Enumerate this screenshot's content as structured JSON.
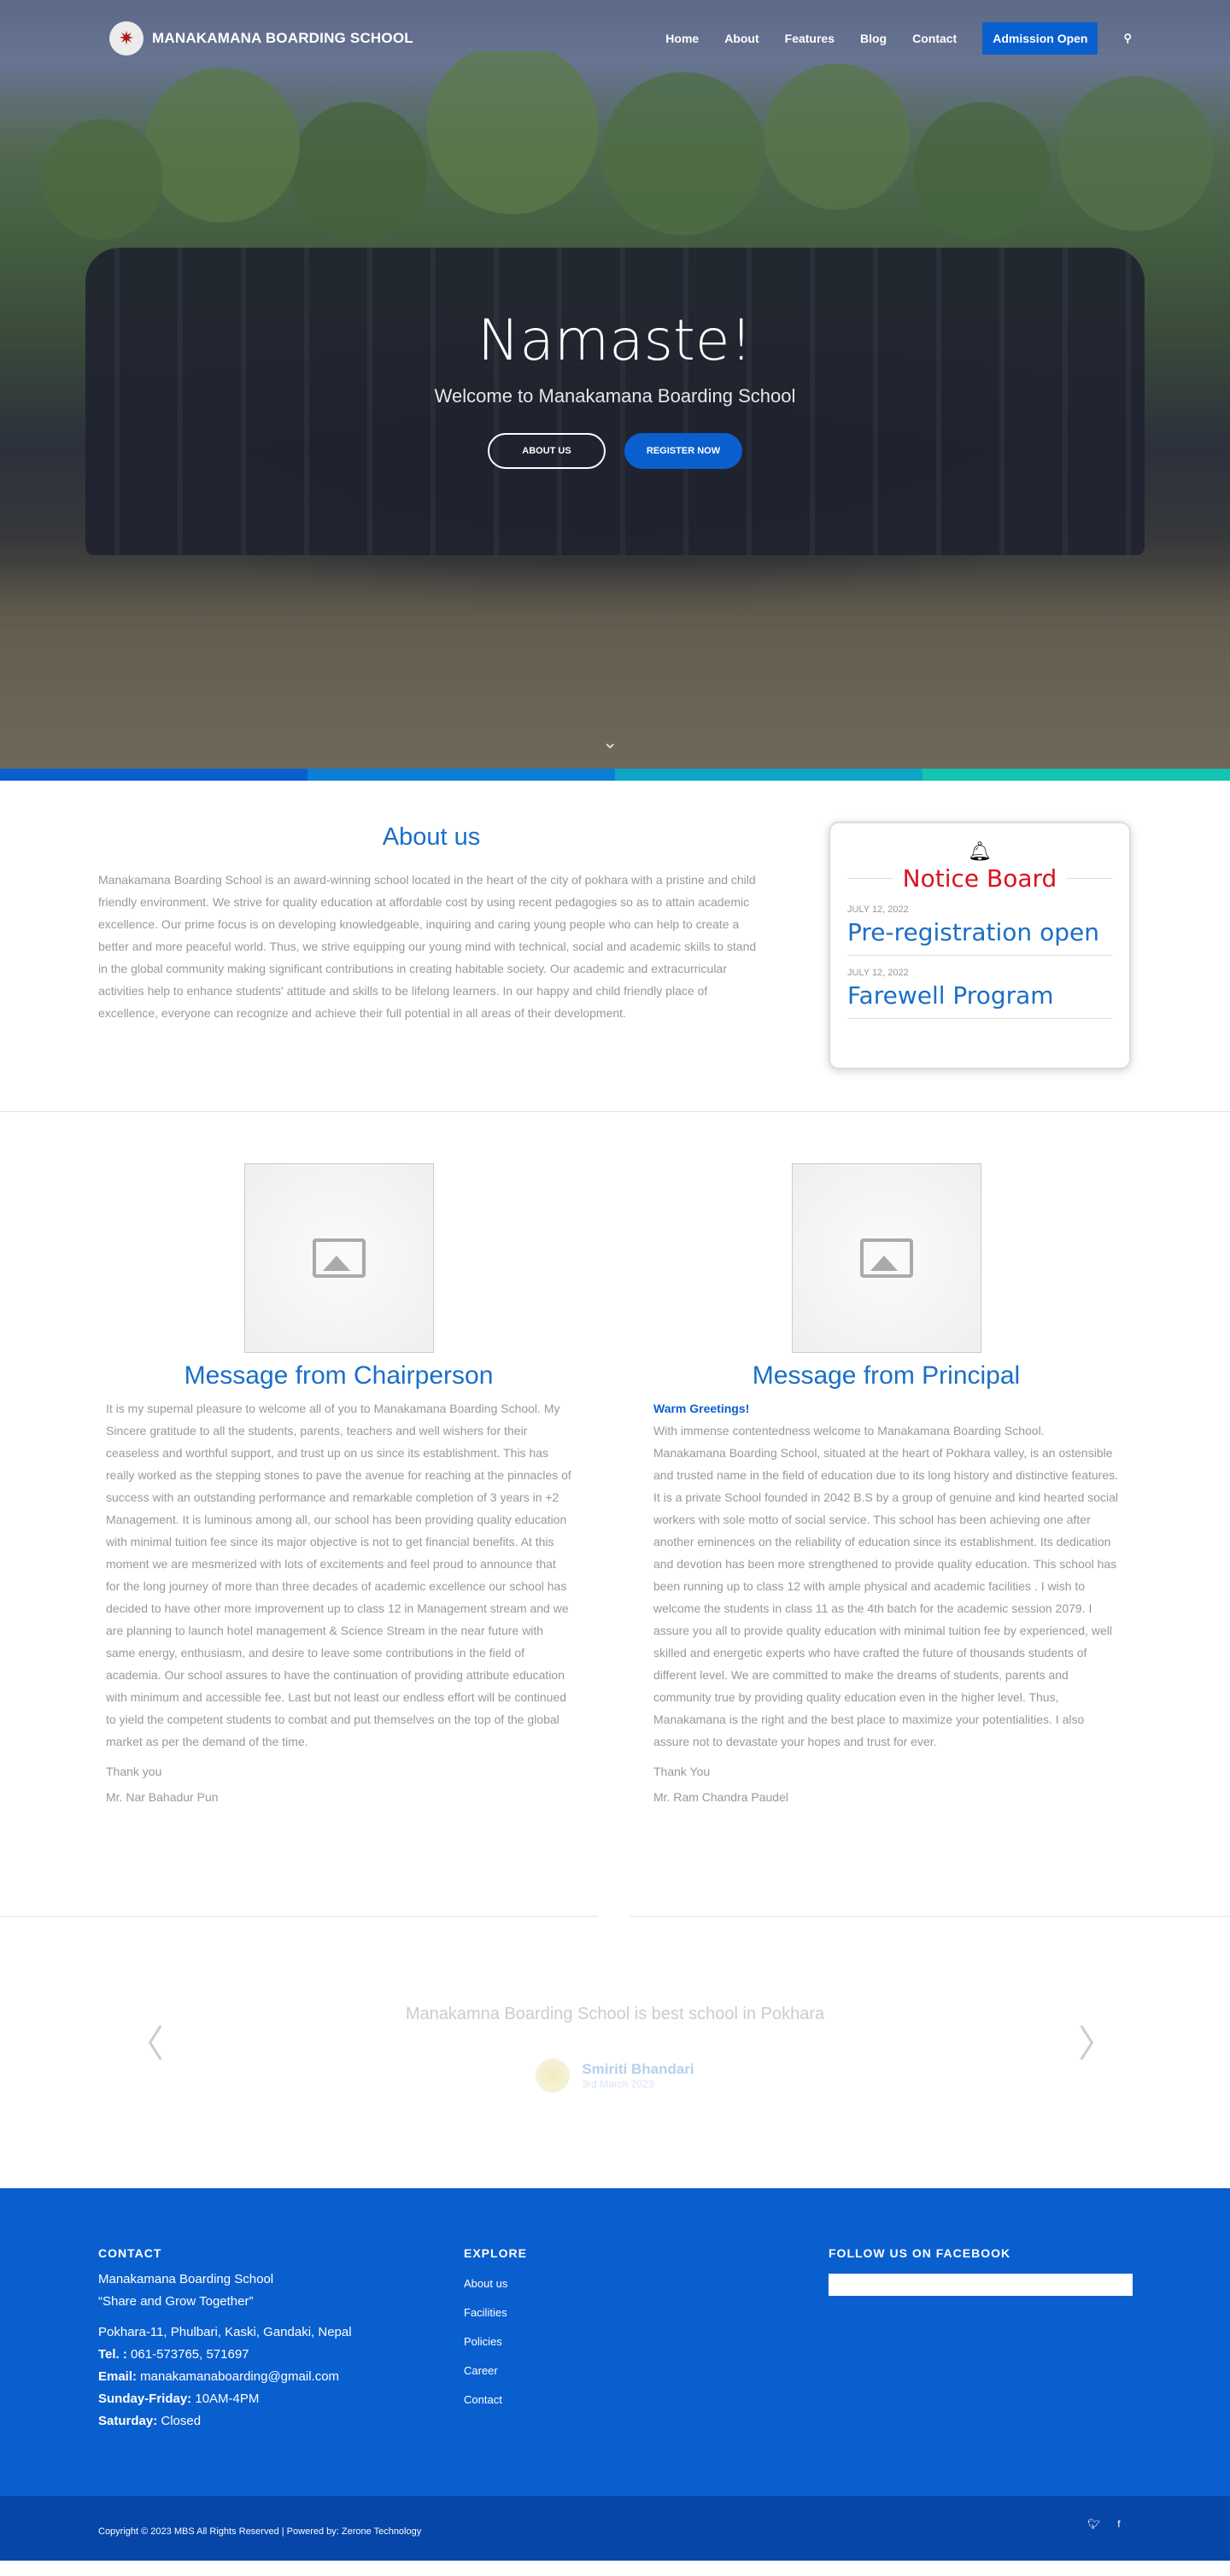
{
  "header": {
    "logo_text": "MANAKAMANA BOARDING SCHOOL",
    "logo_icon": "school-crest",
    "nav": [
      "Home",
      "About",
      "Features",
      "Blog",
      "Contact"
    ],
    "admission_label": "Admission Open",
    "search_icon": "search-icon"
  },
  "hero": {
    "title": "Namaste!",
    "subtitle": "Welcome to Manakamana Boarding School",
    "about_btn": "ABOUT US",
    "register_btn": "REGISTER NOW"
  },
  "stripe_colors": [
    "#0a5fcf",
    "#0b7fd6",
    "#0ea5c9",
    "#11c5b2"
  ],
  "about": {
    "title": "About us",
    "text": "Manakamana Boarding School is an award-winning school located in the heart of the city of pokhara with a pristine and child friendly environment. We strive for quality education at affordable cost by using recent pedagogies so as to attain academic excellence. Our prime focus is on developing knowledgeable, inquiring and caring young people who can help to create a better and more peaceful world. Thus, we strive equipping our young mind with technical, social and academic skills to stand in the global community making significant contributions in creating habitable society. Our academic and extracurricular activities help to enhance students' attitude and skills to be lifelong learners. In our happy and child friendly place of excellence, everyone can recognize and achieve their full potential in all areas of their development."
  },
  "notice": {
    "title": "Notice Board",
    "items": [
      {
        "date": "JULY 12, 2022",
        "title": "Pre-registration open"
      },
      {
        "date": "JULY 12, 2022",
        "title": "Farewell Program"
      }
    ]
  },
  "chairperson": {
    "title": "Message from Chairperson",
    "body": "It is my supernal pleasure to welcome all of you to Manakamana Boarding School. My Sincere gratitude to all the students, parents, teachers and well wishers for their ceaseless and worthful support, and trust up on us since its establishment. This has really worked as the stepping stones to pave the avenue for reaching at the pinnacles of success with an outstanding performance and remarkable completion of 3 years in +2 Management. It is luminous among all, our school has been providing quality education with minimal tuition fee since its major objective is not to get financial benefits. At this  moment we are mesmerized with lots of excitements and feel proud to announce that for the long journey of more than three decades of academic excellence our school has decided to have other more improvement up to class 12 in Management stream and we are planning to launch hotel management & Science Stream in the near future with same energy, enthusiasm, and desire to leave some contributions in the field of academia. Our school assures to have the continuation of providing attribute education with minimum and accessible fee. Last but not least our endless effort will be continued to yield the competent students to combat and put themselves on the top of the global market as per the demand of the time.",
    "sign": "Thank you",
    "name": "Mr. Nar Bahadur Pun"
  },
  "principal": {
    "title": "Message from Principal",
    "greeting": "Warm Greetings!",
    "body": "With immense contentedness welcome  to Manakamana Boarding School. Manakamana Boarding School, situated at the heart of Pokhara valley, is an ostensible and trusted name in the field of education due to its long history and distinctive features. It is a private School founded in 2042 B.S by a group of genuine and kind hearted social workers with sole motto of social service. This school has been achieving one after another eminences on the reliability of education since its establishment. Its dedication and devotion has been more strengthened to provide quality education. This school has been running up to class 12 with ample physical and academic facilities . I wish to welcome the students in class 11 as the 4th batch for the academic session 2079. I assure you all to provide quality education with minimal tuition fee by experienced, well skilled and energetic experts who have crafted the future of thousands students of different level. We are committed to make the dreams of students, parents and community true by providing quality education even in the higher level. Thus, Manakamana is the right and the best place to maximize your potentialities. I also assure not to devastate your hopes and trust for ever.",
    "sign": "Thank You",
    "name": "Mr. Ram Chandra Paudel"
  },
  "testimonial": {
    "quote": "Manakamna Boarding School is best school in Pokhara",
    "name": "Smiriti Bhandari",
    "date": "3rd March 2023"
  },
  "footer": {
    "contact_heading": "CONTACT",
    "school_name": "Manakamana Boarding School",
    "motto": "“Share and Grow Together”",
    "address": "Pokhara-11, Phulbari, Kaski, Gandaki, Nepal",
    "tel_label": "Tel. :",
    "tel": " 061-573765, 571697",
    "email_label": "Email:",
    "email": " manakamanaboarding@gmail.com",
    "sunfri_label": "Sunday-Friday:",
    "sunfri": " 10AM-4PM",
    "sat_label": "Saturday:",
    "sat": " Closed",
    "explore_heading": "EXPLORE",
    "explore_links": [
      "About us",
      "Facilities",
      "Policies",
      "Career",
      "Contact"
    ],
    "facebook_heading": "FOLLOW US ON FACEBOOK",
    "copyright": "Copyright © 2023 MBS All Rights Reserved | Powered by: Zerone Technology",
    "twitter_icon": "twitter-icon",
    "facebook_icon": "facebook-icon"
  }
}
